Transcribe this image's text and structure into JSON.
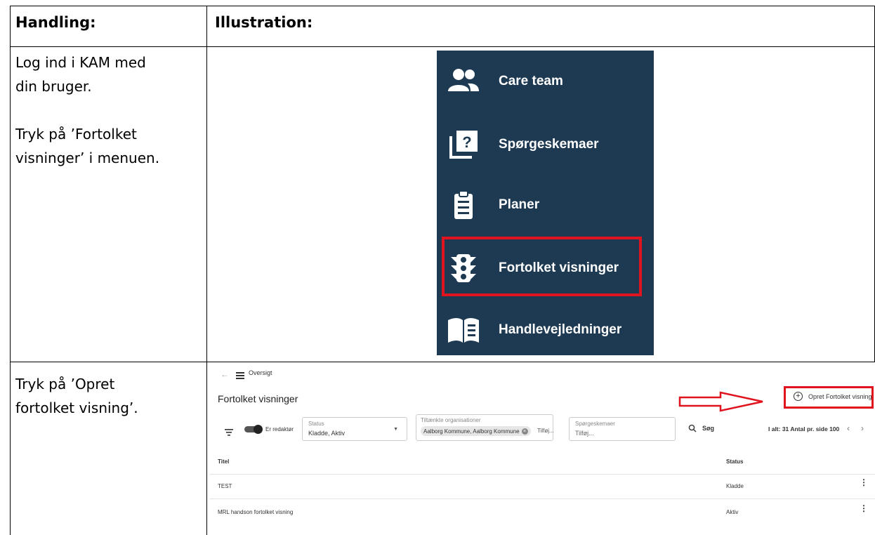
{
  "table": {
    "col1_header": "Handling:",
    "col2_header": "Illustration:",
    "row1_text": [
      "Log ind i KAM med",
      "din bruger."
    ],
    "row1_text2": [
      "Tryk på ’Fortolket",
      "visninger’ i menuen."
    ],
    "row2_text": [
      "Tryk på ’Opret",
      "fortolket visning’."
    ]
  },
  "menu": {
    "items": [
      {
        "label": "Care team",
        "icon": "people-icon"
      },
      {
        "label": "Spørgeskemaer",
        "icon": "questionnaire-icon"
      },
      {
        "label": "Planer",
        "icon": "clipboard-icon"
      },
      {
        "label": "Fortolket visninger",
        "icon": "traffic-light-icon"
      },
      {
        "label": "Handlevejledninger",
        "icon": "book-icon"
      }
    ],
    "highlight_color": "#e0141e",
    "bg_color": "#1e3a52"
  },
  "screen": {
    "breadcrumb": "Oversigt",
    "page_title": "Fortolket visninger",
    "create_button": "Opret Fortolket visning",
    "toggle_label": "Er redaktør",
    "status_label": "Status",
    "status_value": "Kladde, Aktiv",
    "org_label": "Tiltænkte organisationer",
    "org_value": "Aalborg Kommune, Aalborg Kommune",
    "org_add": "Tilføj...",
    "quest_label": "Spørgeskemaer",
    "quest_placeholder": "Tilføj...",
    "search_label": "Søg",
    "paging": "I alt: 31 Antal pr. side 100",
    "col_title": "Titel",
    "col_status": "Status",
    "rows": [
      {
        "title": "TEST",
        "status": "Kladde"
      },
      {
        "title": "MRL handson fortolket visning",
        "status": "Aktiv"
      }
    ]
  }
}
